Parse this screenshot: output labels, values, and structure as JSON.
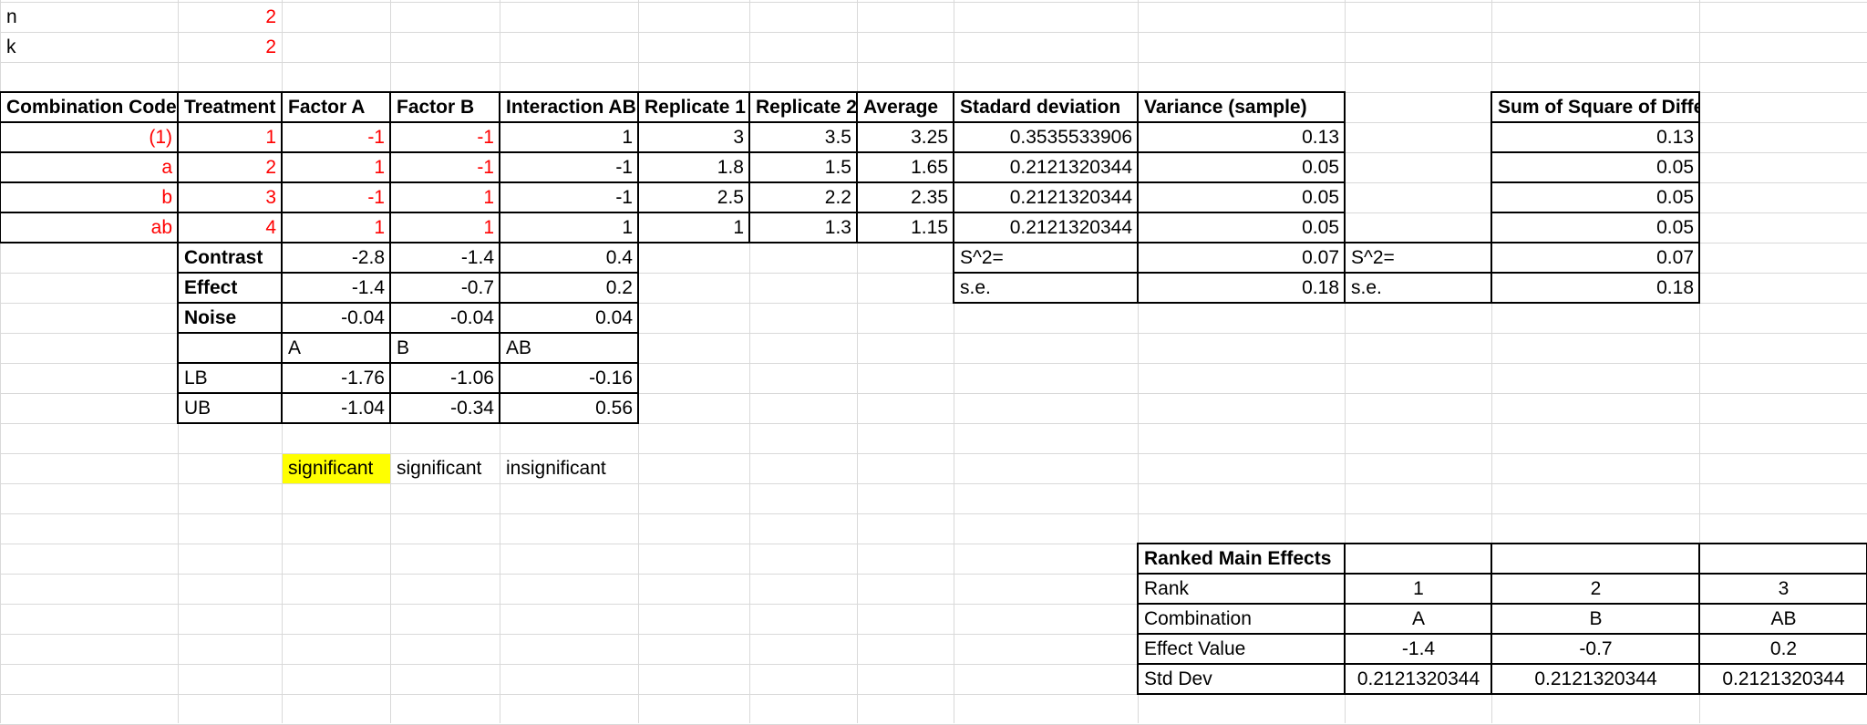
{
  "params": {
    "n_label": "n",
    "n_value": "2",
    "k_label": "k",
    "k_value": "2"
  },
  "main_table": {
    "headers": [
      "Combination Code",
      "Treatment",
      "Factor A",
      "Factor B",
      "Interaction AB",
      "Replicate 1",
      "Replicate 2",
      "Average",
      "Stadard deviation",
      "Variance (sample)"
    ],
    "rows": [
      [
        "(1)",
        "1",
        "-1",
        "-1",
        "1",
        "3",
        "3.5",
        "3.25",
        "0.3535533906",
        "0.13"
      ],
      [
        "a",
        "2",
        "1",
        "-1",
        "-1",
        "1.8",
        "1.5",
        "1.65",
        "0.2121320344",
        "0.05"
      ],
      [
        "b",
        "3",
        "-1",
        "1",
        "-1",
        "2.5",
        "2.2",
        "2.35",
        "0.2121320344",
        "0.05"
      ],
      [
        "ab",
        "4",
        "1",
        "1",
        "1",
        "1",
        "1.3",
        "1.15",
        "0.2121320344",
        "0.05"
      ]
    ]
  },
  "effects_table": {
    "rows": [
      [
        "Contrast",
        "-2.8",
        "-1.4",
        "0.4"
      ],
      [
        "Effect",
        "-1.4",
        "-0.7",
        "0.2"
      ],
      [
        "Noise",
        "-0.04",
        "-0.04",
        "0.04"
      ]
    ],
    "ci_headers": [
      "A",
      "B",
      "AB"
    ],
    "ci_rows": [
      [
        "LB",
        "-1.76",
        "-1.06",
        "-0.16"
      ],
      [
        "UB",
        "-1.04",
        "-0.34",
        "0.56"
      ]
    ]
  },
  "variance_summary": [
    {
      "label": "S^2=",
      "value": "0.07"
    },
    {
      "label": "s.e.",
      "value": "0.18"
    }
  ],
  "ssd_table": {
    "header": "Sum of Square of Difference",
    "values": [
      "0.13",
      "0.05",
      "0.05",
      "0.05"
    ],
    "summary": [
      {
        "label": "S^2=",
        "value": "0.07"
      },
      {
        "label": "s.e.",
        "value": "0.18"
      }
    ]
  },
  "significance": [
    "significant",
    "significant",
    "insignificant"
  ],
  "ranked_table": {
    "title": "Ranked Main Effects",
    "rows": [
      [
        "Rank",
        "1",
        "2",
        "3"
      ],
      [
        "Combination",
        "A",
        "B",
        "AB"
      ],
      [
        "Effect Value",
        "-1.4",
        "-0.7",
        "0.2"
      ],
      [
        "Std Dev",
        "0.2121320344",
        "0.2121320344",
        "0.2121320344"
      ]
    ]
  },
  "colors": {
    "grid": "#d9d9d9",
    "border": "#000000",
    "red_text": "#ff0000",
    "highlight": "#ffff00"
  }
}
